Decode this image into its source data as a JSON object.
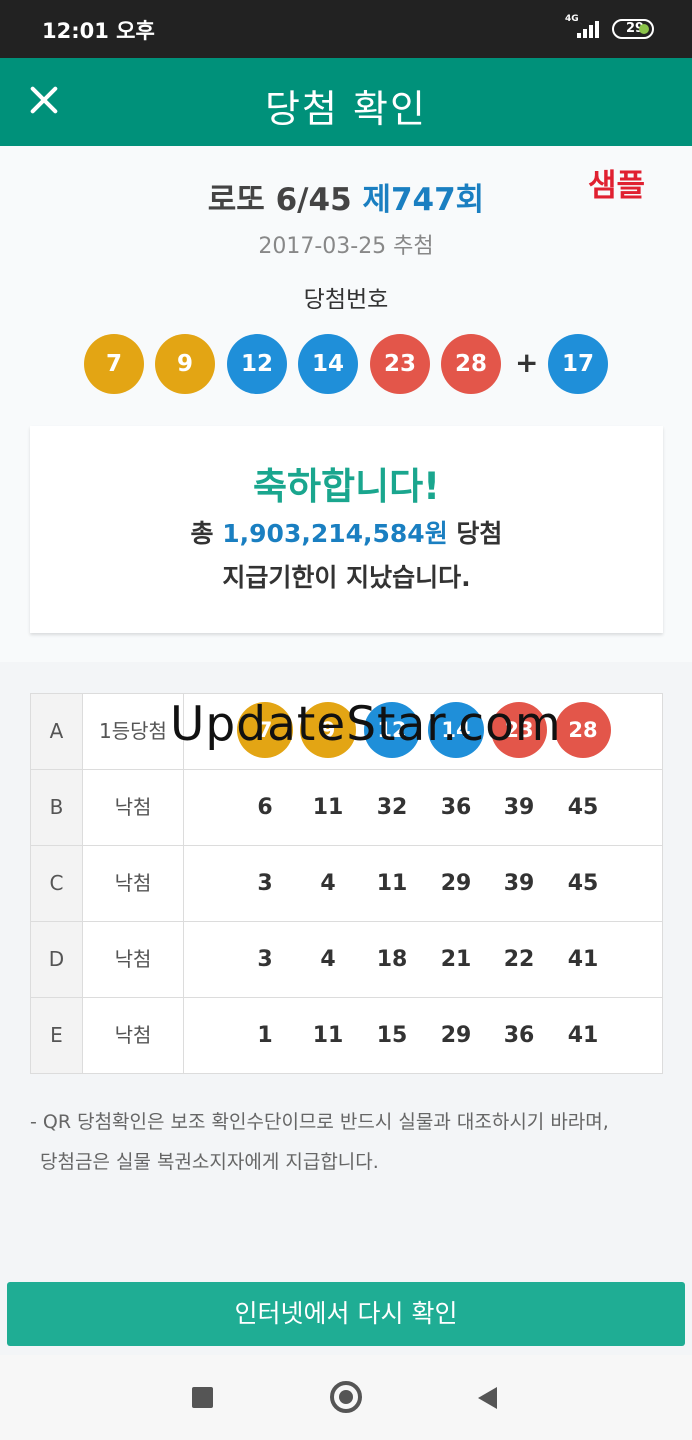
{
  "status_bar": {
    "time": "12:01 오후",
    "network": "4G",
    "battery": "29"
  },
  "header": {
    "title": "당첨 확인"
  },
  "lotto": {
    "name": "로또 6/45",
    "draw": "제747회",
    "date": "2017-03-25 추첨",
    "sample_label": "샘플",
    "winning_label": "당첨번호",
    "winning_numbers": [
      {
        "value": "7",
        "color": "#e3a514"
      },
      {
        "value": "9",
        "color": "#e3a514"
      },
      {
        "value": "12",
        "color": "#1f8fd9"
      },
      {
        "value": "14",
        "color": "#1f8fd9"
      },
      {
        "value": "23",
        "color": "#e3564a"
      },
      {
        "value": "28",
        "color": "#e3564a"
      }
    ],
    "plus": "+",
    "bonus_number": {
      "value": "17",
      "color": "#1f8fd9"
    }
  },
  "result": {
    "congrats": "축하합니다!",
    "amount_prefix": "총 ",
    "amount": "1,903,214,584원",
    "amount_suffix": " 당첨",
    "expired": "지급기한이 지났습니다."
  },
  "tickets": [
    {
      "letter": "A",
      "status": "1등당첨",
      "numbers": [
        "7",
        "9",
        "12",
        "14",
        "23",
        "28"
      ],
      "matched": true
    },
    {
      "letter": "B",
      "status": "낙첨",
      "numbers": [
        "6",
        "11",
        "32",
        "36",
        "39",
        "45"
      ],
      "matched": false
    },
    {
      "letter": "C",
      "status": "낙첨",
      "numbers": [
        "3",
        "4",
        "11",
        "29",
        "39",
        "45"
      ],
      "matched": false
    },
    {
      "letter": "D",
      "status": "낙첨",
      "numbers": [
        "3",
        "4",
        "18",
        "21",
        "22",
        "41"
      ],
      "matched": false
    },
    {
      "letter": "E",
      "status": "낙첨",
      "numbers": [
        "1",
        "11",
        "15",
        "29",
        "36",
        "41"
      ],
      "matched": false
    }
  ],
  "watermark": "UpdateStar.com",
  "notice": {
    "line1": "- QR 당첨확인은 보조 확인수단이므로 반드시 실물과 대조하시기 바라며,",
    "line2": "당첨금은 실물 복권소지자에게 지급합니다."
  },
  "recheck_button": "인터넷에서 다시 확인",
  "ball_colors": {
    "yellow": "#e3a514",
    "blue": "#1f8fd9",
    "red": "#e3564a"
  },
  "accent_color": "#00917a"
}
